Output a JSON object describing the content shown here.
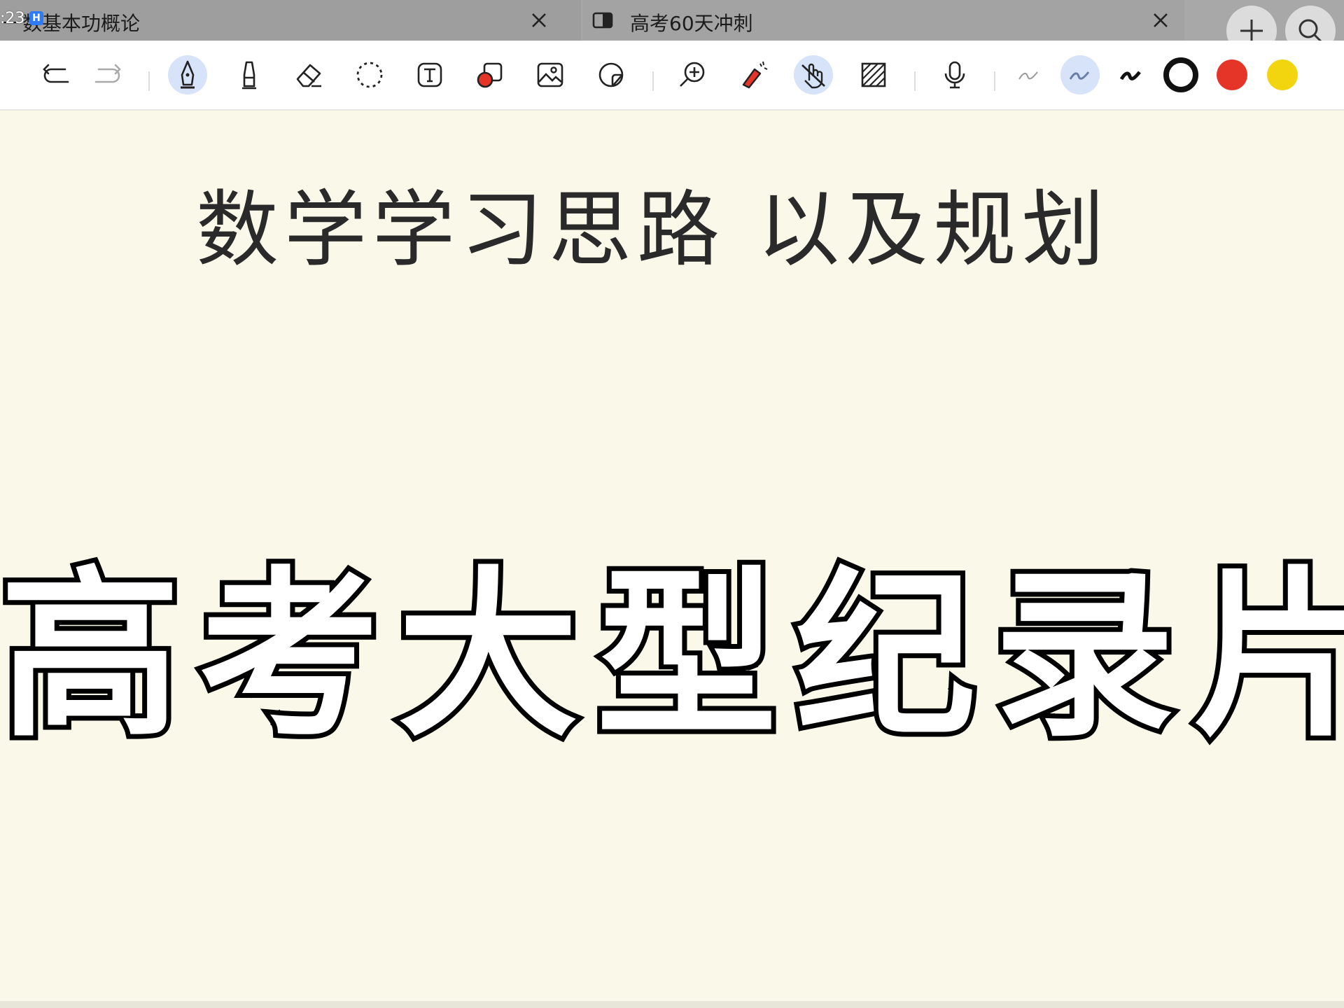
{
  "status": {
    "time": ":23",
    "badge": "H"
  },
  "tabs": [
    {
      "title": "一数基本功概论",
      "active": false
    },
    {
      "title": "高考60天冲刺",
      "active": true
    }
  ],
  "tab_actions": [
    "add-icon",
    "search-icon"
  ],
  "toolbar": {
    "tools": [
      "undo-icon",
      "redo-icon",
      "pen-icon",
      "highlighter-icon",
      "eraser-icon",
      "lasso-icon",
      "text-icon",
      "shape-icon",
      "image-icon",
      "sticker-icon",
      "zoom-icon",
      "laser-pointer-icon",
      "touch-draw-icon",
      "ruled-paper-icon",
      "microphone-icon",
      "thin-stroke-icon",
      "medium-stroke-icon",
      "thick-stroke-icon"
    ],
    "active_tools": [
      "pen-icon",
      "touch-draw-icon",
      "medium-stroke-icon"
    ],
    "colors": [
      "#111111",
      "#e53528",
      "#f3d50f"
    ],
    "selected_color": "#111111"
  },
  "canvas": {
    "background": "#faf8e8",
    "handwritten_title": "数学学习思路 以及规划",
    "headline": "高考大型纪录片"
  }
}
